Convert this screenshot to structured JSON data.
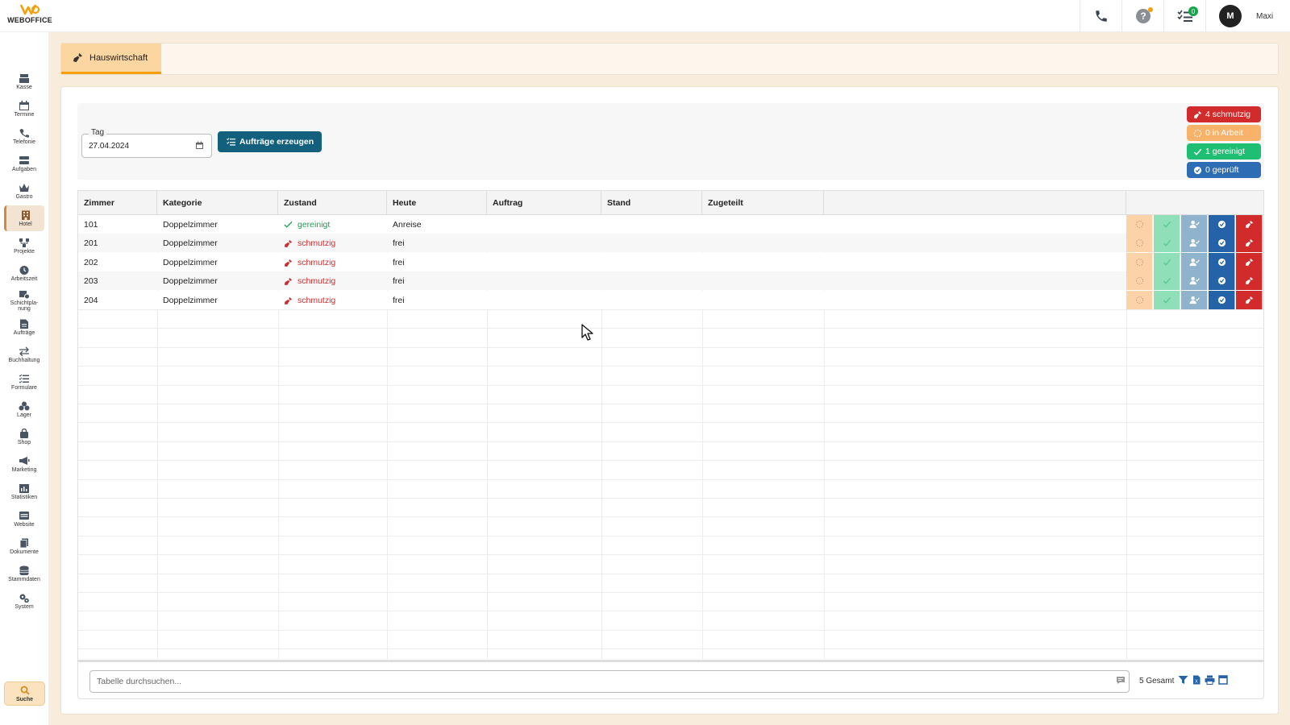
{
  "app": {
    "logo_text": "WEBOFFICE"
  },
  "topbar": {
    "tasks_badge": "0",
    "avatar_initial": "M",
    "user_name": "Maxi"
  },
  "sidebar": {
    "items": [
      {
        "label": "Kasse",
        "icon": "cash-register-icon"
      },
      {
        "label": "Termine",
        "icon": "calendar-icon"
      },
      {
        "label": "Telefonie",
        "icon": "phone-icon"
      },
      {
        "label": "Aufgaben",
        "icon": "tasks-icon"
      },
      {
        "label": "Gastro",
        "icon": "crown-icon"
      },
      {
        "label": "Hotel",
        "icon": "hotel-icon"
      },
      {
        "label": "Projekte",
        "icon": "projects-icon"
      },
      {
        "label": "Arbeitszeit",
        "icon": "clock-icon"
      },
      {
        "label": "Schichtpla-nung",
        "icon": "shift-planning-icon"
      },
      {
        "label": "Aufträge",
        "icon": "orders-icon"
      },
      {
        "label": "Buchhaltung",
        "icon": "arrows-icon"
      },
      {
        "label": "Formulare",
        "icon": "forms-icon"
      },
      {
        "label": "Lager",
        "icon": "boxes-icon"
      },
      {
        "label": "Shop",
        "icon": "bag-icon"
      },
      {
        "label": "Marketing",
        "icon": "megaphone-icon"
      },
      {
        "label": "Statistiken",
        "icon": "chart-icon"
      },
      {
        "label": "Website",
        "icon": "website-icon"
      },
      {
        "label": "Dokumente",
        "icon": "documents-icon"
      },
      {
        "label": "Stammdaten",
        "icon": "database-icon"
      },
      {
        "label": "System",
        "icon": "gears-icon"
      }
    ],
    "active": "Hotel",
    "search_label": "Suche"
  },
  "tab": {
    "label": "Hauswirtschaft"
  },
  "filter": {
    "date_label": "Tag",
    "date_value": "27.04.2024",
    "generate_button": "Aufträge erzeugen"
  },
  "status_counts": [
    {
      "label": "4 schmutzig",
      "color": "#d22b2b"
    },
    {
      "label": "0 in Arbeit",
      "color": "#f8b26a"
    },
    {
      "label": "1 gereinigt",
      "color": "#1fbf73"
    },
    {
      "label": "0 geprüft",
      "color": "#2e6db3"
    }
  ],
  "table": {
    "columns": [
      "Zimmer",
      "Kategorie",
      "Zustand",
      "Heute",
      "Auftrag",
      "Stand",
      "Zugeteilt"
    ],
    "rows": [
      {
        "zimmer": "101",
        "kategorie": "Doppelzimmer",
        "zustand": "gereinigt",
        "heute": "Anreise",
        "auftrag": "",
        "stand": "",
        "zugeteilt": ""
      },
      {
        "zimmer": "201",
        "kategorie": "Doppelzimmer",
        "zustand": "schmutzig",
        "heute": "frei",
        "auftrag": "",
        "stand": "",
        "zugeteilt": ""
      },
      {
        "zimmer": "202",
        "kategorie": "Doppelzimmer",
        "zustand": "schmutzig",
        "heute": "frei",
        "auftrag": "",
        "stand": "",
        "zugeteilt": ""
      },
      {
        "zimmer": "203",
        "kategorie": "Doppelzimmer",
        "zustand": "schmutzig",
        "heute": "frei",
        "auftrag": "",
        "stand": "",
        "zugeteilt": ""
      },
      {
        "zimmer": "204",
        "kategorie": "Doppelzimmer",
        "zustand": "schmutzig",
        "heute": "frei",
        "auftrag": "",
        "stand": "",
        "zugeteilt": ""
      }
    ],
    "row_actions": [
      {
        "name": "in-arbeit-action",
        "color": "#fcd3a8"
      },
      {
        "name": "gereinigt-action",
        "color": "#8fe0b9"
      },
      {
        "name": "zuteilen-action",
        "color": "#8fb3cc"
      },
      {
        "name": "geprueft-action",
        "color": "#2463a8"
      },
      {
        "name": "schmutzig-action",
        "color": "#d22b2b"
      }
    ]
  },
  "footer": {
    "search_placeholder": "Tabelle durchsuchen...",
    "total": "5 Gesamt"
  }
}
